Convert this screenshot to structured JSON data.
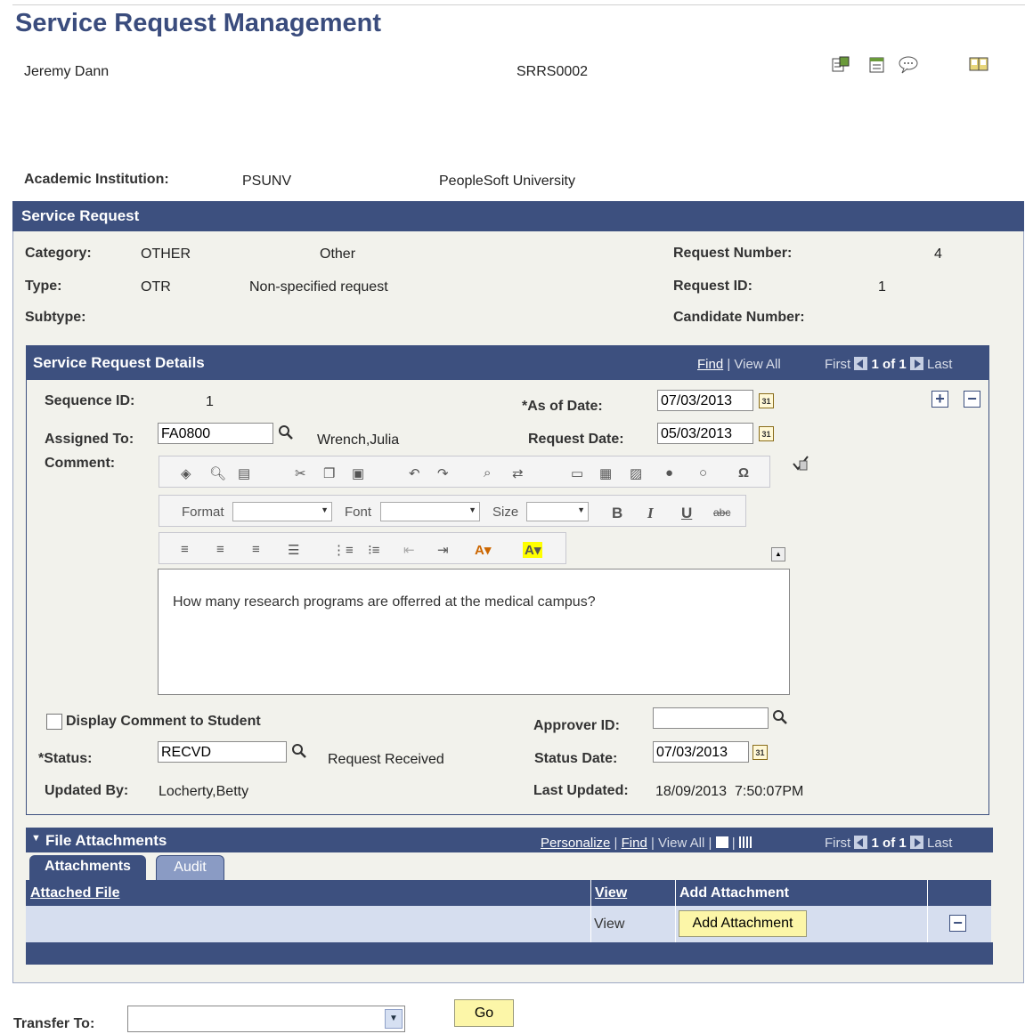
{
  "page": {
    "title": "Service Request Management"
  },
  "header": {
    "name": "Jeremy Dann",
    "id": "SRRS0002",
    "icons": [
      "notify-icon",
      "notepad-icon",
      "comment-icon",
      "book-icon"
    ]
  },
  "institution": {
    "label": "Academic Institution:",
    "code": "PSUNV",
    "name": "PeopleSoft University"
  },
  "service_request": {
    "title": "Service Request",
    "category_label": "Category:",
    "category_code": "OTHER",
    "category_desc": "Other",
    "type_label": "Type:",
    "type_code": "OTR",
    "type_desc": "Non-specified request",
    "subtype_label": "Subtype:",
    "request_number_label": "Request Number:",
    "request_number": "4",
    "request_id_label": "Request ID:",
    "request_id": "1",
    "candidate_number_label": "Candidate Number:"
  },
  "details": {
    "title": "Service Request Details",
    "nav": {
      "find": "Find",
      "view_all": "View All",
      "first": "First",
      "count": "1 of 1",
      "last": "Last"
    },
    "sequence_label": "Sequence ID:",
    "sequence": "1",
    "as_of_date_label": "*As of Date:",
    "as_of_date": "07/03/2013",
    "assigned_to_label": "Assigned To:",
    "assigned_to": "FA0800",
    "assigned_name": "Wrench,Julia",
    "request_date_label": "Request Date:",
    "request_date": "05/03/2013",
    "comment_label": "Comment:",
    "toolbar": {
      "format": "Format",
      "font": "Font",
      "size": "Size",
      "bold": "B",
      "italic": "I",
      "underline": "U",
      "strike": "abc",
      "omega": "Ω"
    },
    "comment_text": "How many research programs are offerred at the medical campus?",
    "display_comment_label": "Display Comment to Student",
    "approver_label": "Approver ID:",
    "approver": "",
    "status_label": "*Status:",
    "status": "RECVD",
    "status_desc": "Request Received",
    "status_date_label": "Status Date:",
    "status_date": "07/03/2013",
    "updated_by_label": "Updated By:",
    "updated_by": "Locherty,Betty",
    "last_updated_label": "Last Updated:",
    "last_updated": "18/09/2013  7:50:07PM"
  },
  "attachments": {
    "title": "File Attachments",
    "nav": {
      "personalize": "Personalize",
      "find": "Find",
      "view_all": "View All",
      "first": "First",
      "count": "1 of 1",
      "last": "Last"
    },
    "tabs": [
      "Attachments",
      "Audit"
    ],
    "columns": [
      "Attached File",
      "View",
      "Add Attachment"
    ],
    "row": {
      "view": "View",
      "add_button": "Add Attachment"
    }
  },
  "footer": {
    "transfer_label": "Transfer To:",
    "go_button": "Go"
  }
}
